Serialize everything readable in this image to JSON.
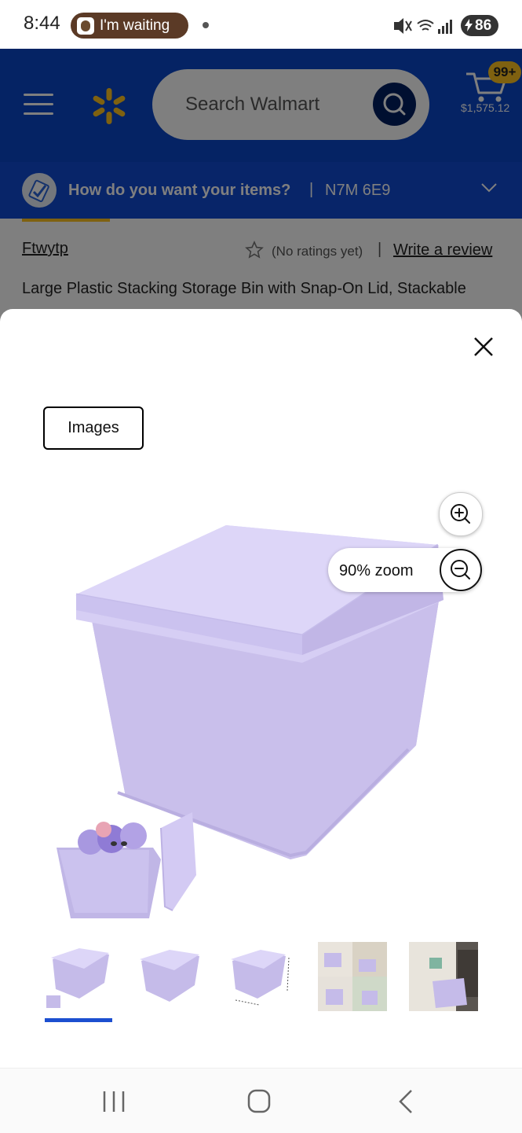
{
  "status_bar": {
    "time": "8:44",
    "notification_text": "I'm waiting",
    "battery": "86"
  },
  "header": {
    "search_placeholder": "Search Walmart",
    "cart_badge": "99+",
    "cart_total": "$1,575.12",
    "brand_color": "#0b47c8",
    "accent_color": "#ffc220"
  },
  "delivery": {
    "question": "How do you want your items?",
    "separator": "|",
    "postal_code": "N7M 6E9"
  },
  "product": {
    "brand": "Ftwytp",
    "rating_text": "(No ratings yet)",
    "separator": "|",
    "review_link": "Write a review",
    "title": "Large Plastic Stacking Storage Bin with Snap-On Lid, Stackable"
  },
  "viewer": {
    "tab_label": "Images",
    "zoom_text": "90% zoom",
    "zoom_value_percent": 90,
    "selected_thumbnail_index": 0,
    "thumbnail_count": 5,
    "bin_color": "#c9c0ec"
  },
  "icons": [
    "menu-icon",
    "walmart-spark-icon",
    "search-icon",
    "cart-icon",
    "location-icon",
    "chevron-down-icon",
    "star-outline-icon",
    "close-icon",
    "zoom-in-icon",
    "zoom-out-icon",
    "recent-apps-icon",
    "home-icon",
    "back-icon"
  ]
}
